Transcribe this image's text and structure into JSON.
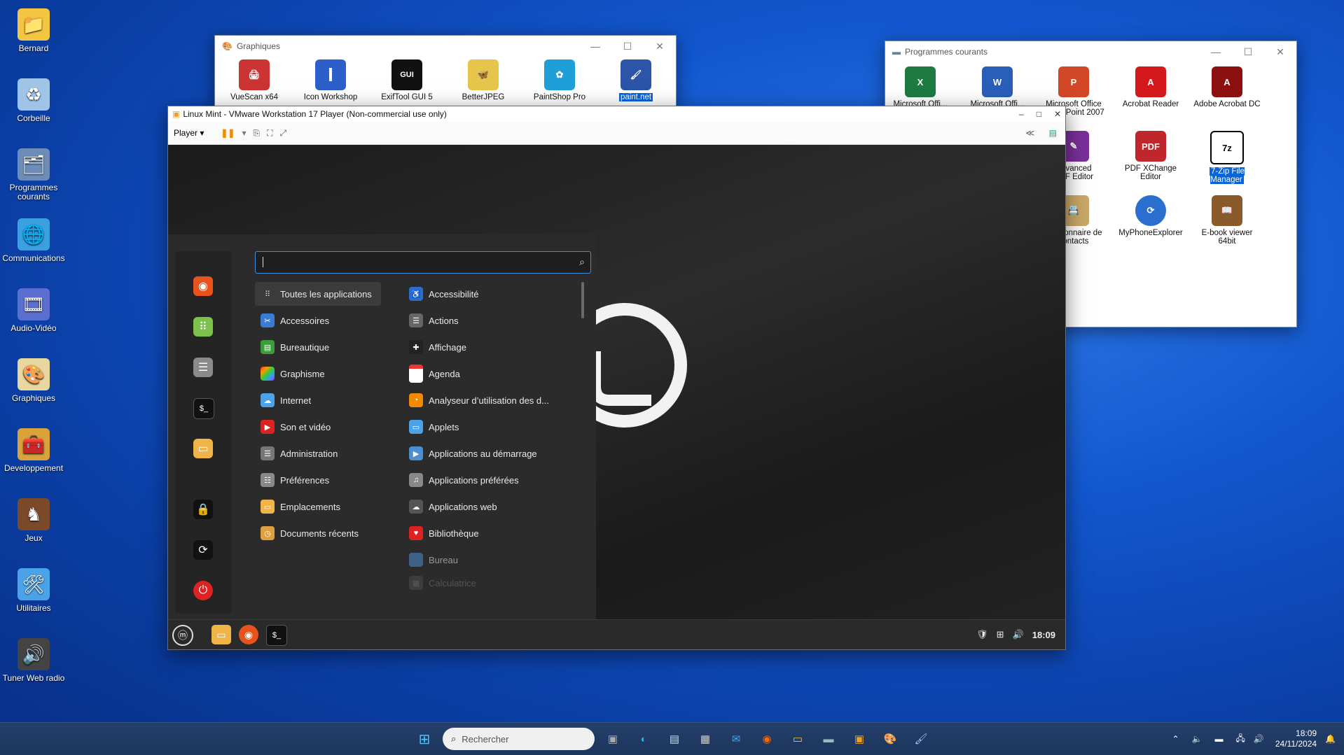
{
  "desktop": {
    "icons": [
      {
        "label": "Bernard"
      },
      {
        "label": "Corbeille"
      },
      {
        "label": "Programmes\ncourants"
      },
      {
        "label": "Communications"
      },
      {
        "label": "Audio-Vidéo"
      },
      {
        "label": "Graphiques"
      },
      {
        "label": "Developpement"
      },
      {
        "label": "Jeux"
      },
      {
        "label": "Utilitaires"
      },
      {
        "label": "Tuner Web radio"
      }
    ]
  },
  "graphiques_window": {
    "title": "Graphiques",
    "apps": [
      {
        "label": "VueScan x64"
      },
      {
        "label": "Icon Workshop"
      },
      {
        "label": "ExifTool GUI 5"
      },
      {
        "label": "BetterJPEG"
      },
      {
        "label": "PaintShop Pro"
      },
      {
        "label": "paint.net"
      }
    ]
  },
  "programmes_window": {
    "title": "Programmes courants",
    "apps": [
      {
        "label": "Microsoft Offi..."
      },
      {
        "label": "Microsoft Offi..."
      },
      {
        "label": "Microsoft Office\nPowerPoint 2007"
      },
      {
        "label": "Acrobat Reader"
      },
      {
        "label": "Adobe Acrobat DC"
      },
      {
        "label": "Advanced\nPDF Editor"
      },
      {
        "label": "PDF XChange\nEditor"
      },
      {
        "label": "7-Zip File Manager"
      },
      {
        "label": "Gestionnaire de\ncontacts"
      },
      {
        "label": "MyPhoneExplorer"
      },
      {
        "label": "E-book viewer 64bit"
      }
    ]
  },
  "vmware": {
    "title": "Linux Mint - VMware Workstation 17 Player (Non-commercial use only)",
    "player_label": "Player"
  },
  "mint_menu": {
    "search": {
      "value": ""
    },
    "categories": [
      {
        "label": "Toutes les applications",
        "active": true
      },
      {
        "label": "Accessoires"
      },
      {
        "label": "Bureautique"
      },
      {
        "label": "Graphisme"
      },
      {
        "label": "Internet"
      },
      {
        "label": "Son et vidéo"
      },
      {
        "label": "Administration"
      },
      {
        "label": "Préférences"
      },
      {
        "label": "Emplacements"
      },
      {
        "label": "Documents récents"
      }
    ],
    "apps": [
      {
        "label": "Accessibilité"
      },
      {
        "label": "Actions"
      },
      {
        "label": "Affichage"
      },
      {
        "label": "Agenda"
      },
      {
        "label": "Analyseur d’utilisation des d..."
      },
      {
        "label": "Applets"
      },
      {
        "label": "Applications au démarrage"
      },
      {
        "label": "Applications préférées"
      },
      {
        "label": "Applications web"
      },
      {
        "label": "Bibliothèque"
      },
      {
        "label": "Bureau"
      },
      {
        "label": "Calculatrice"
      }
    ]
  },
  "mint_panel": {
    "clock": "18:09"
  },
  "taskbar": {
    "search_placeholder": "Rechercher",
    "time": "18:09",
    "date": "24/11/2024"
  }
}
